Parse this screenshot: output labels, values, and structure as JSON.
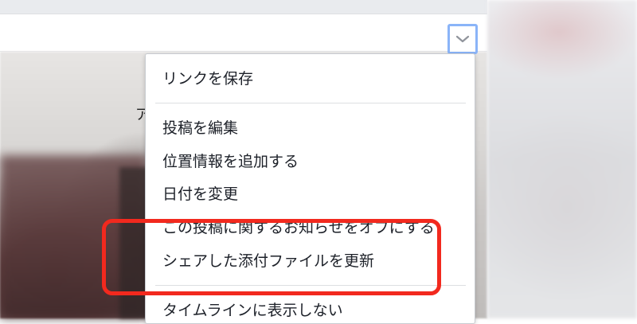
{
  "post": {
    "header_peek_glyph": "ア"
  },
  "menu": {
    "items": [
      {
        "label": "リンクを保存"
      },
      {
        "label": "投稿を編集"
      },
      {
        "label": "位置情報を追加する"
      },
      {
        "label": "日付を変更"
      },
      {
        "label": "この投稿に関するお知らせをオフにする"
      },
      {
        "label": "シェアした添付ファイルを更新"
      },
      {
        "label": "タイムラインに表示しない"
      }
    ]
  },
  "colors": {
    "highlight_border": "#f2291e",
    "chevron_focus_ring": "#8ab4f8"
  },
  "icons": {
    "menu_toggle": "chevron-down-icon"
  }
}
